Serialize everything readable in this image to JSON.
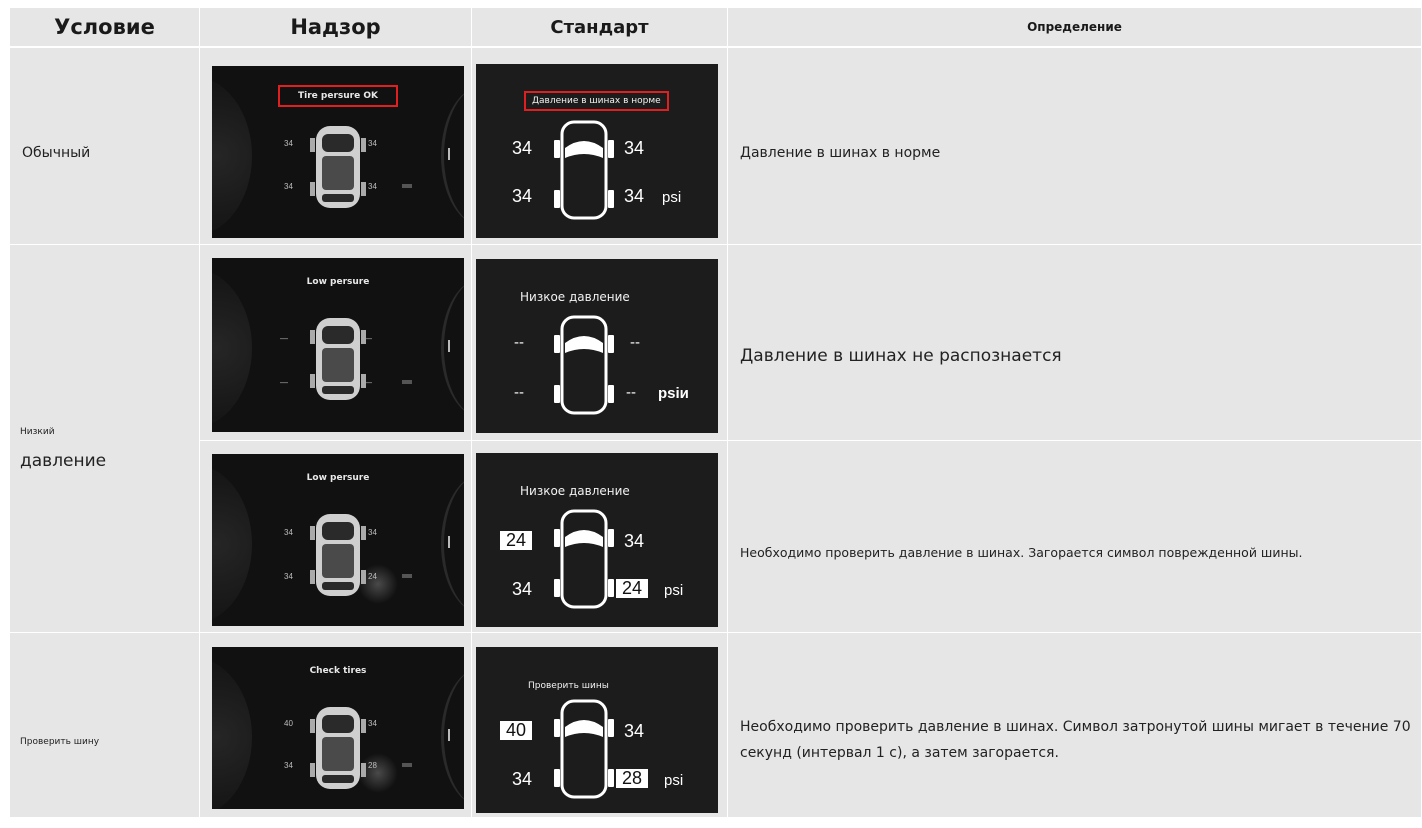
{
  "headers": {
    "condition": "Условие",
    "monitor": "Надзор",
    "standard": "Стандарт",
    "definition": "Определение"
  },
  "rows": {
    "normal": {
      "condition": "Обычный",
      "monitor": {
        "title": "Tire persure OK",
        "values": [
          "34",
          "34",
          "34",
          "34"
        ]
      },
      "standard": {
        "title": "Давление в шинах в норме",
        "values": [
          "34",
          "34",
          "34",
          "34"
        ],
        "unit": "psi"
      },
      "definition": "Давление в шинах в норме"
    },
    "low": {
      "condition_small": "Низкий",
      "condition_large": "давление",
      "first": {
        "monitor": {
          "title": "Low persure",
          "values": [
            "—",
            "—",
            "—",
            "—"
          ]
        },
        "standard": {
          "title": "Низкое давление",
          "values": [
            "--",
            "--",
            "--",
            "--"
          ],
          "unit": "psiи"
        },
        "definition": "Давление в шинах не распознается"
      },
      "second": {
        "monitor": {
          "title": "Low persure",
          "values": [
            "34",
            "34",
            "34",
            "24"
          ]
        },
        "standard": {
          "title": "Низкое давление",
          "values": [
            "24",
            "34",
            "34",
            "24"
          ],
          "unit": "psi"
        },
        "definition": "Необходимо проверить давление в шинах. Загорается символ поврежденной шины."
      }
    },
    "check": {
      "condition": "Проверить шину",
      "monitor": {
        "title": "Check tires",
        "values": [
          "40",
          "34",
          "34",
          "28"
        ]
      },
      "standard": {
        "title": "Проверить шины",
        "values": [
          "40",
          "34",
          "34",
          "28"
        ],
        "unit": "psi"
      },
      "definition": "Необходимо проверить давление в шинах. Символ затронутой шины мигает в течение 70 секунд (интервал 1 с), а затем загорается."
    }
  }
}
